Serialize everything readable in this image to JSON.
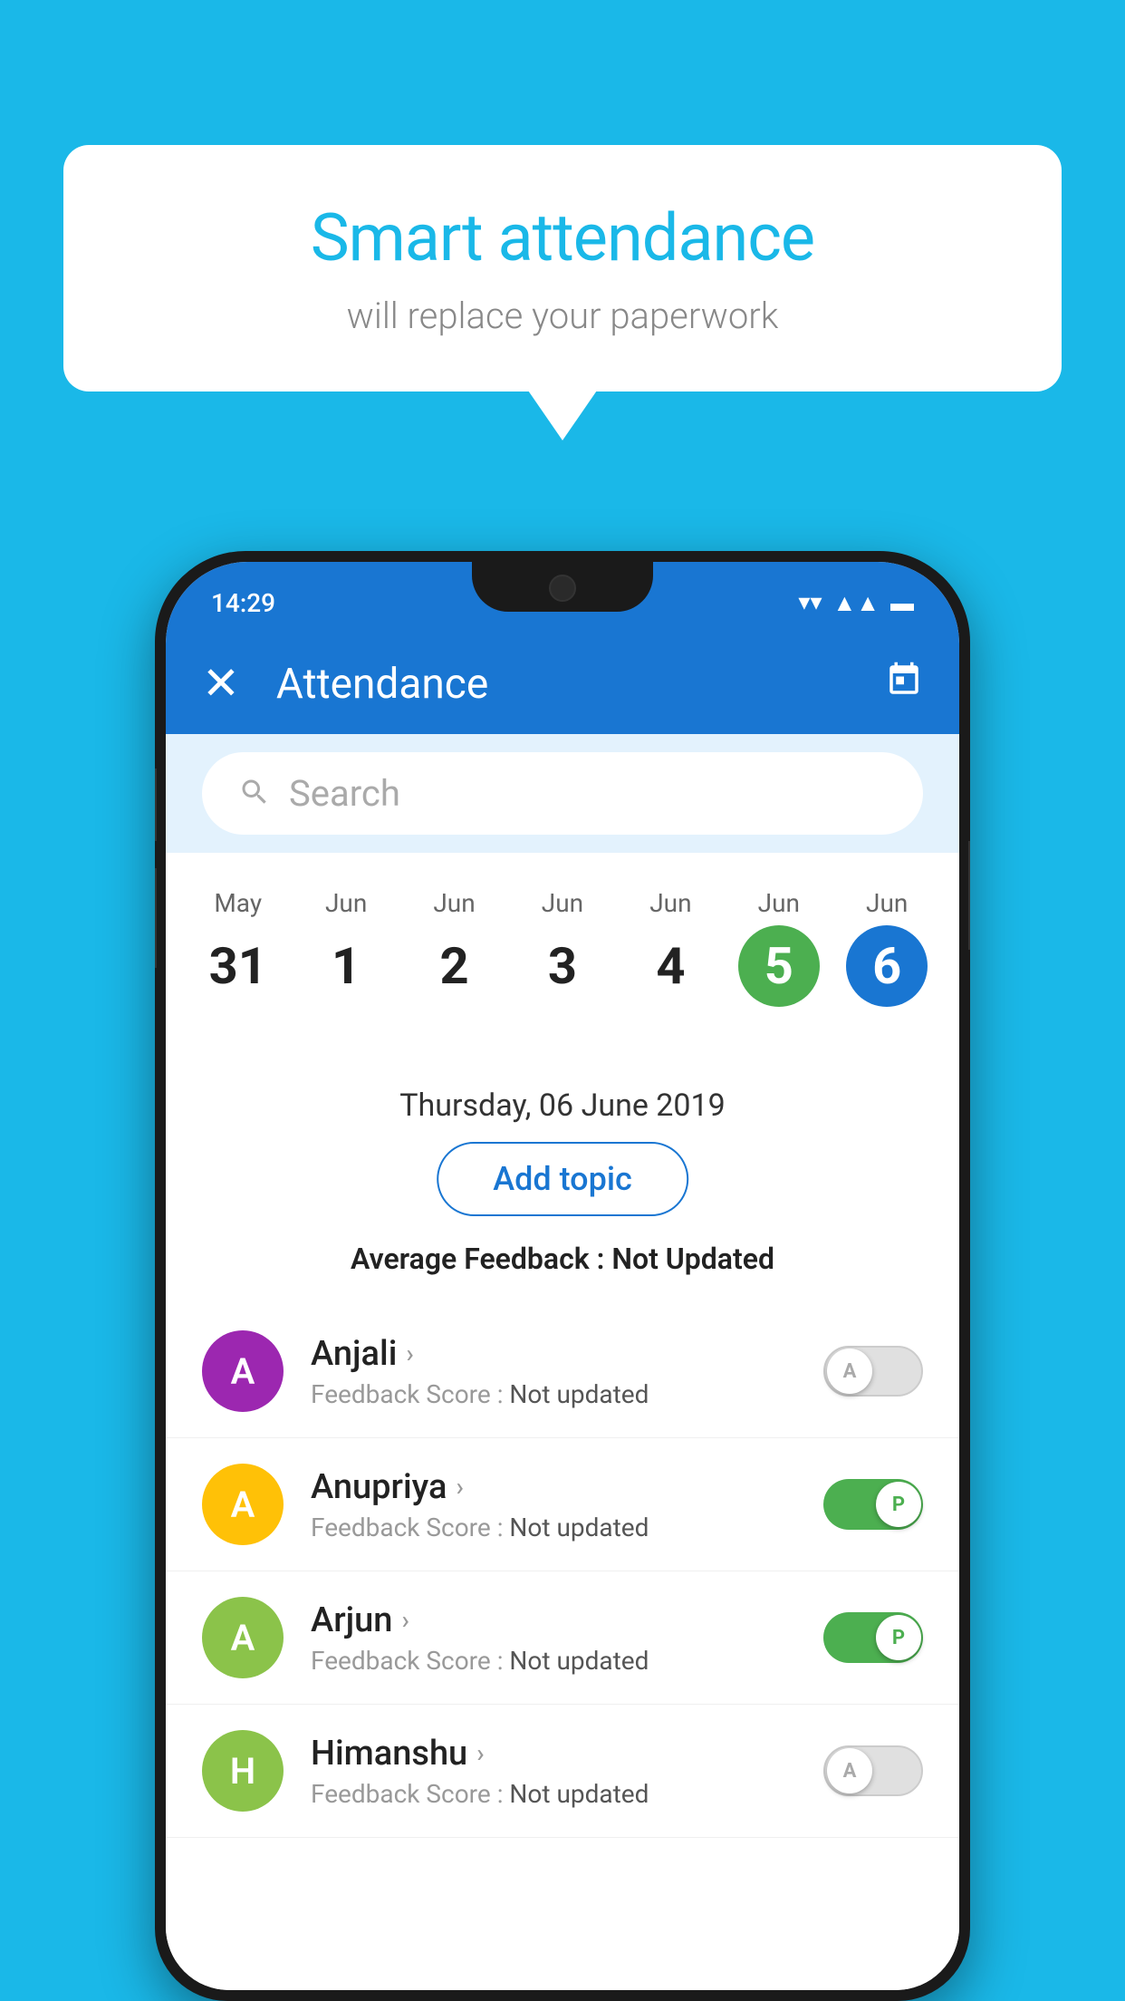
{
  "background_color": "#1AB8E8",
  "speech_bubble": {
    "title": "Smart attendance",
    "subtitle": "will replace your paperwork"
  },
  "status_bar": {
    "time": "14:29",
    "wifi": "▼",
    "signal": "▲",
    "battery": "▪"
  },
  "app_header": {
    "title": "Attendance",
    "close_label": "✕",
    "calendar_label": "📅"
  },
  "search": {
    "placeholder": "Search"
  },
  "calendar": {
    "days": [
      {
        "month": "May",
        "date": "31",
        "type": "normal"
      },
      {
        "month": "Jun",
        "date": "1",
        "type": "normal"
      },
      {
        "month": "Jun",
        "date": "2",
        "type": "normal"
      },
      {
        "month": "Jun",
        "date": "3",
        "type": "normal"
      },
      {
        "month": "Jun",
        "date": "4",
        "type": "normal"
      },
      {
        "month": "Jun",
        "date": "5",
        "type": "today"
      },
      {
        "month": "Jun",
        "date": "6",
        "type": "selected"
      }
    ]
  },
  "selected_date": {
    "label": "Thursday, 06 June 2019"
  },
  "add_topic_button": "Add topic",
  "average_feedback": {
    "label": "Average Feedback : ",
    "value": "Not Updated"
  },
  "students": [
    {
      "name": "Anjali",
      "avatar_letter": "A",
      "avatar_color": "#9C27B0",
      "feedback_label": "Feedback Score : ",
      "feedback_value": "Not updated",
      "toggle": "off",
      "toggle_letter": "A"
    },
    {
      "name": "Anupriya",
      "avatar_letter": "A",
      "avatar_color": "#FFC107",
      "feedback_label": "Feedback Score : ",
      "feedback_value": "Not updated",
      "toggle": "on",
      "toggle_letter": "P"
    },
    {
      "name": "Arjun",
      "avatar_letter": "A",
      "avatar_color": "#8BC34A",
      "feedback_label": "Feedback Score : ",
      "feedback_value": "Not updated",
      "toggle": "on",
      "toggle_letter": "P"
    },
    {
      "name": "Himanshu",
      "avatar_letter": "H",
      "avatar_color": "#8BC34A",
      "feedback_label": "Feedback Score : ",
      "feedback_value": "Not updated",
      "toggle": "off",
      "toggle_letter": "A"
    }
  ]
}
